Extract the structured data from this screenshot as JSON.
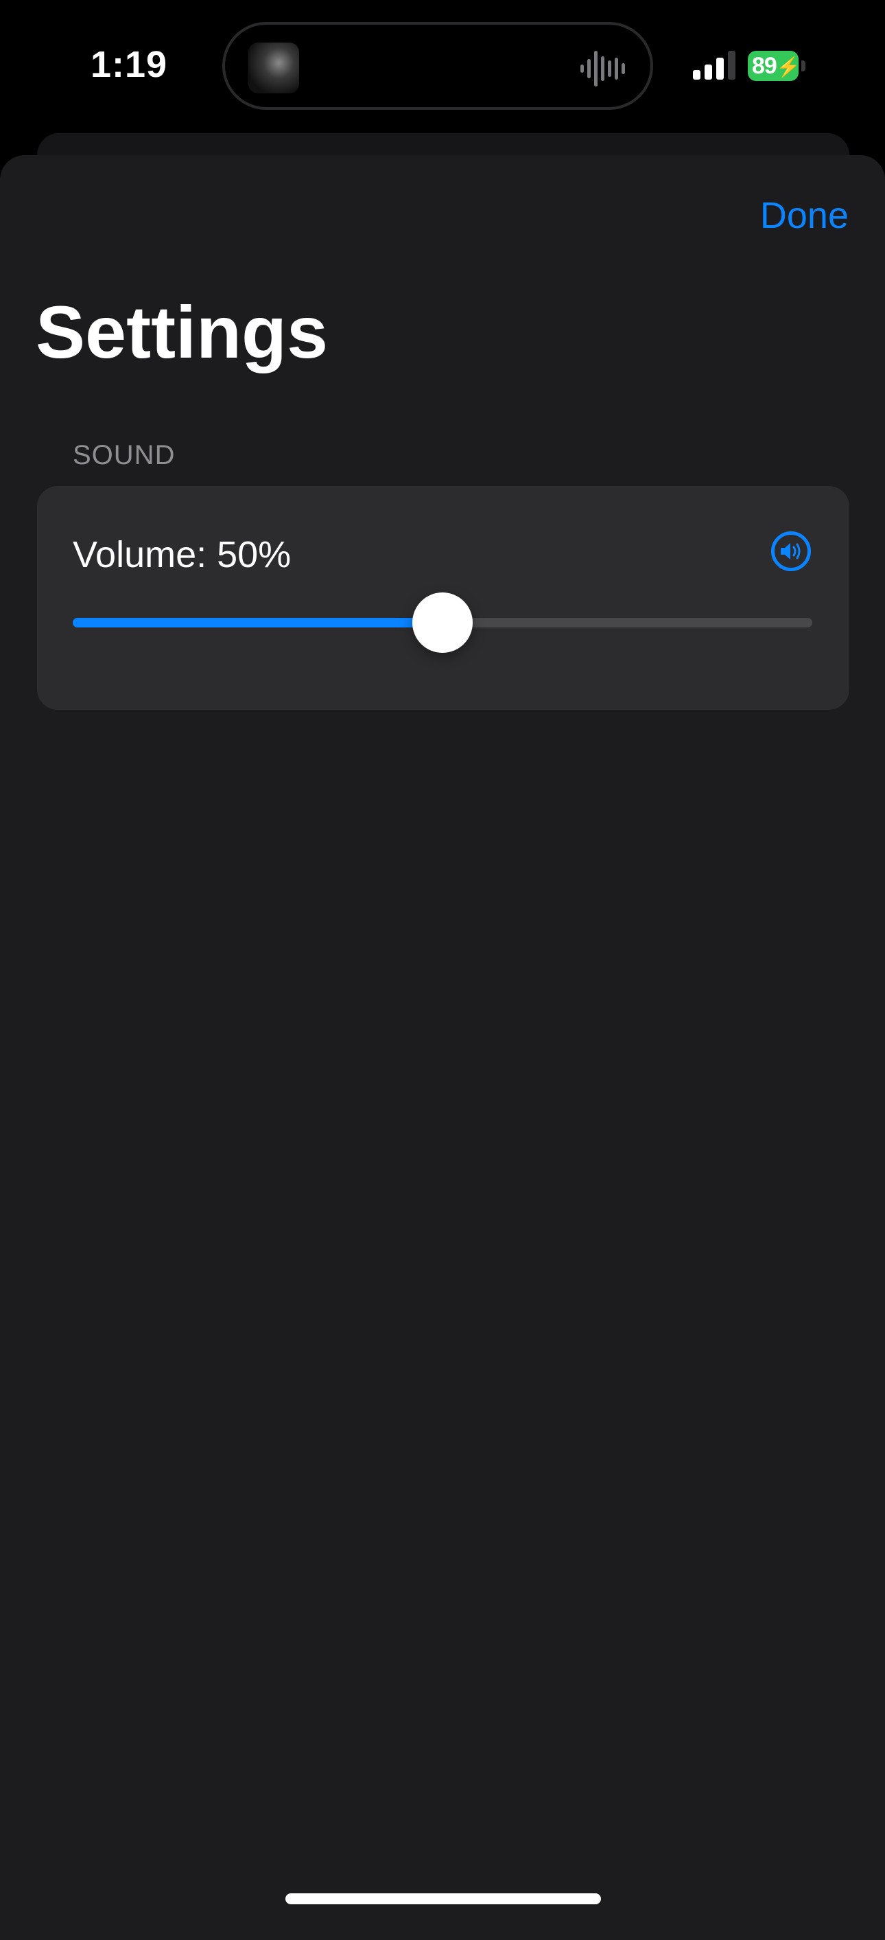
{
  "status_bar": {
    "time": "1:19",
    "battery_level": "89",
    "battery_charging": true,
    "signal_bars_filled": 3,
    "signal_bars_total": 4,
    "battery_color": "#34c759"
  },
  "header": {
    "done_label": "Done",
    "title": "Settings"
  },
  "sound_section": {
    "header": "SOUND",
    "volume_label": "Volume: 50%",
    "volume_value": 0.5,
    "speaker_icon": "speaker-wave-circle-icon"
  },
  "colors": {
    "accent": "#0a84ff",
    "sheet_background": "#1c1c1e",
    "group_background": "#2c2c2e",
    "secondary_text": "#8e8e93"
  }
}
